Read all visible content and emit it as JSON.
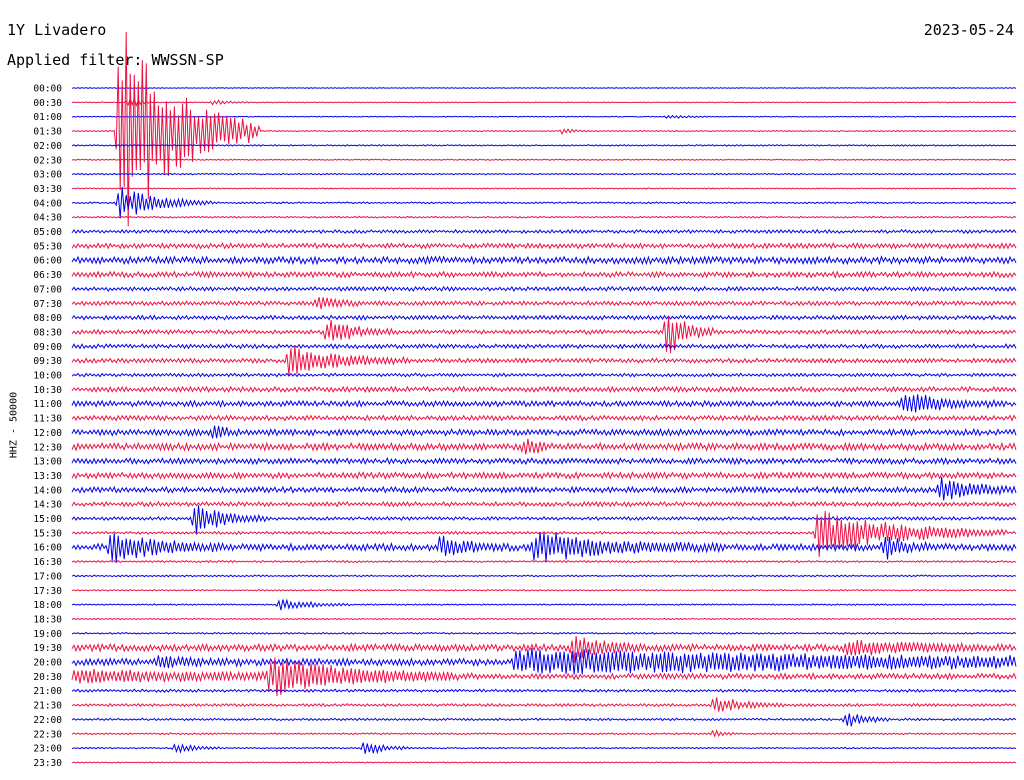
{
  "header": {
    "station": "1Y Livadero",
    "filter_label": "Applied filter: WWSSN-SP",
    "date": "2023-05-24"
  },
  "chart_data": {
    "type": "line",
    "title": "1Y Livadero",
    "subtitle": "Applied filter: WWSSN-SP",
    "date": "2023-05-24",
    "ylabel": "HHZ - 50000",
    "xlabel": "",
    "trace_minutes": 30,
    "colors": {
      "odd": "#0000ee",
      "even": "#ee1144"
    },
    "rows": [
      "00:00",
      "00:30",
      "01:00",
      "01:30",
      "02:00",
      "02:30",
      "03:00",
      "03:30",
      "04:00",
      "04:30",
      "05:00",
      "05:30",
      "06:00",
      "06:30",
      "07:00",
      "07:30",
      "08:00",
      "08:30",
      "09:00",
      "09:30",
      "10:00",
      "10:30",
      "11:00",
      "11:30",
      "12:00",
      "12:30",
      "13:00",
      "13:30",
      "14:00",
      "14:30",
      "15:00",
      "15:30",
      "16:00",
      "16:30",
      "17:00",
      "17:30",
      "18:00",
      "18:30",
      "19:00",
      "19:30",
      "20:00",
      "20:30",
      "21:00",
      "21:30",
      "22:00",
      "22:30",
      "23:00",
      "23:30"
    ],
    "noise": [
      0.3,
      0.3,
      0.3,
      0.4,
      0.5,
      0.4,
      0.5,
      0.4,
      0.6,
      0.6,
      1.2,
      1.8,
      2.5,
      2.0,
      1.5,
      1.5,
      1.5,
      1.5,
      1.5,
      1.6,
      1.2,
      1.8,
      2.0,
      1.8,
      2.2,
      2.5,
      2.0,
      2.2,
      2.0,
      1.6,
      1.2,
      1.0,
      2.5,
      0.7,
      0.6,
      0.5,
      0.5,
      0.5,
      0.6,
      2.5,
      2.5,
      2.0,
      1.0,
      1.0,
      0.8,
      0.6,
      0.5,
      0.4
    ],
    "events": [
      {
        "row": 1,
        "x": 0.06,
        "amp": 7,
        "dur": 0.01
      },
      {
        "row": 1,
        "x": 0.15,
        "amp": 3,
        "dur": 0.015
      },
      {
        "row": 2,
        "x": 0.63,
        "amp": 2,
        "dur": 0.02
      },
      {
        "row": 3,
        "x": 0.05,
        "amp": 115,
        "dur": 0.06
      },
      {
        "row": 3,
        "x": 0.52,
        "amp": 3,
        "dur": 0.01
      },
      {
        "row": 8,
        "x": 0.05,
        "amp": 18,
        "dur": 0.04
      },
      {
        "row": 15,
        "x": 0.26,
        "amp": 8,
        "dur": 0.02
      },
      {
        "row": 17,
        "x": 0.27,
        "amp": 12,
        "dur": 0.03
      },
      {
        "row": 17,
        "x": 0.63,
        "amp": 25,
        "dur": 0.02
      },
      {
        "row": 19,
        "x": 0.23,
        "amp": 16,
        "dur": 0.05
      },
      {
        "row": 22,
        "x": 0.88,
        "amp": 12,
        "dur": 0.04
      },
      {
        "row": 24,
        "x": 0.15,
        "amp": 8,
        "dur": 0.01
      },
      {
        "row": 25,
        "x": 0.48,
        "amp": 12,
        "dur": 0.01
      },
      {
        "row": 28,
        "x": 0.92,
        "amp": 12,
        "dur": 0.04
      },
      {
        "row": 30,
        "x": 0.13,
        "amp": 18,
        "dur": 0.03
      },
      {
        "row": 31,
        "x": 0.79,
        "amp": 25,
        "dur": 0.08
      },
      {
        "row": 32,
        "x": 0.04,
        "amp": 15,
        "dur": 0.05
      },
      {
        "row": 32,
        "x": 0.39,
        "amp": 10,
        "dur": 0.03
      },
      {
        "row": 32,
        "x": 0.49,
        "amp": 15,
        "dur": 0.08
      },
      {
        "row": 32,
        "x": 0.86,
        "amp": 12,
        "dur": 0.02
      },
      {
        "row": 36,
        "x": 0.22,
        "amp": 6,
        "dur": 0.03
      },
      {
        "row": 39,
        "x": 0.53,
        "amp": 14,
        "dur": 0.03
      },
      {
        "row": 39,
        "x": 0.82,
        "amp": 8,
        "dur": 0.06
      },
      {
        "row": 40,
        "x": 0.47,
        "amp": 12,
        "dur": 0.5
      },
      {
        "row": 40,
        "x": 0.09,
        "amp": 5,
        "dur": 0.04
      },
      {
        "row": 41,
        "x": 0.21,
        "amp": 18,
        "dur": 0.08
      },
      {
        "row": 41,
        "x": 0.0,
        "amp": 6,
        "dur": 0.18
      },
      {
        "row": 43,
        "x": 0.68,
        "amp": 9,
        "dur": 0.03
      },
      {
        "row": 44,
        "x": 0.82,
        "amp": 8,
        "dur": 0.02
      },
      {
        "row": 45,
        "x": 0.68,
        "amp": 4,
        "dur": 0.01
      },
      {
        "row": 46,
        "x": 0.11,
        "amp": 5,
        "dur": 0.02
      },
      {
        "row": 46,
        "x": 0.31,
        "amp": 8,
        "dur": 0.02
      }
    ]
  }
}
